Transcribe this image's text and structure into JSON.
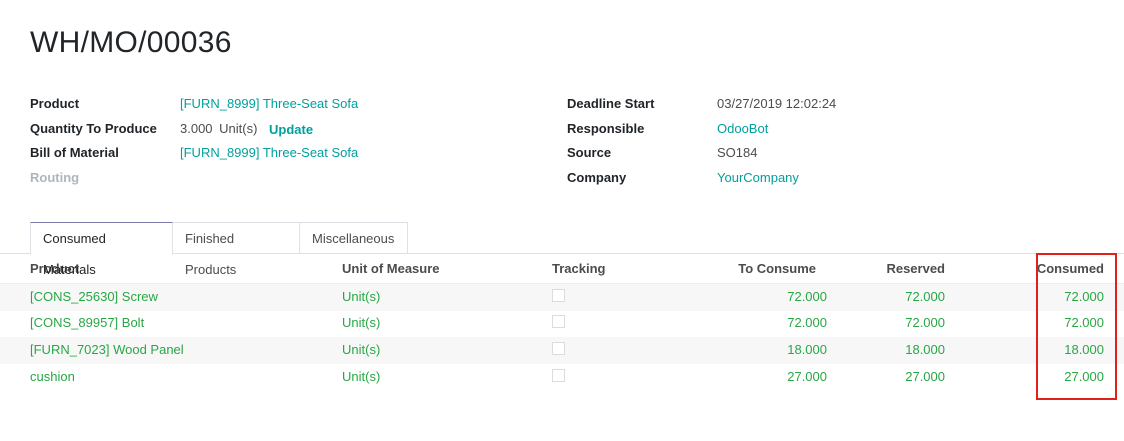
{
  "record": {
    "title": "WH/MO/00036"
  },
  "left_fields": {
    "product_label": "Product",
    "product_value": "[FURN_8999] Three-Seat Sofa",
    "qty_label": "Quantity To Produce",
    "qty_value": "3.000",
    "qty_unit": "Unit(s)",
    "update_label": "Update",
    "bom_label": "Bill of Material",
    "bom_value": "[FURN_8999] Three-Seat Sofa",
    "routing_label": "Routing"
  },
  "right_fields": {
    "deadline_label": "Deadline Start",
    "deadline_value": "03/27/2019 12:02:24",
    "responsible_label": "Responsible",
    "responsible_value": "OdooBot",
    "source_label": "Source",
    "source_value": "SO184",
    "company_label": "Company",
    "company_value": "YourCompany"
  },
  "tabs": [
    {
      "label": "Consumed Materials",
      "active": true
    },
    {
      "label": "Finished Products",
      "active": false
    },
    {
      "label": "Miscellaneous",
      "active": false
    }
  ],
  "table": {
    "columns": [
      "Product",
      "Unit of Measure",
      "Tracking",
      "To Consume",
      "Reserved",
      "Consumed"
    ],
    "rows": [
      {
        "product": "[CONS_25630] Screw",
        "uom": "Unit(s)",
        "to_consume": "72.000",
        "reserved": "72.000",
        "consumed": "72.000"
      },
      {
        "product": "[CONS_89957] Bolt",
        "uom": "Unit(s)",
        "to_consume": "72.000",
        "reserved": "72.000",
        "consumed": "72.000"
      },
      {
        "product": "[FURN_7023] Wood Panel",
        "uom": "Unit(s)",
        "to_consume": "18.000",
        "reserved": "18.000",
        "consumed": "18.000"
      },
      {
        "product": "cushion",
        "uom": "Unit(s)",
        "to_consume": "27.000",
        "reserved": "27.000",
        "consumed": "27.000"
      }
    ]
  },
  "colors": {
    "link": "#00A09D",
    "line_text": "#28a745",
    "highlight": "#e0201b"
  }
}
